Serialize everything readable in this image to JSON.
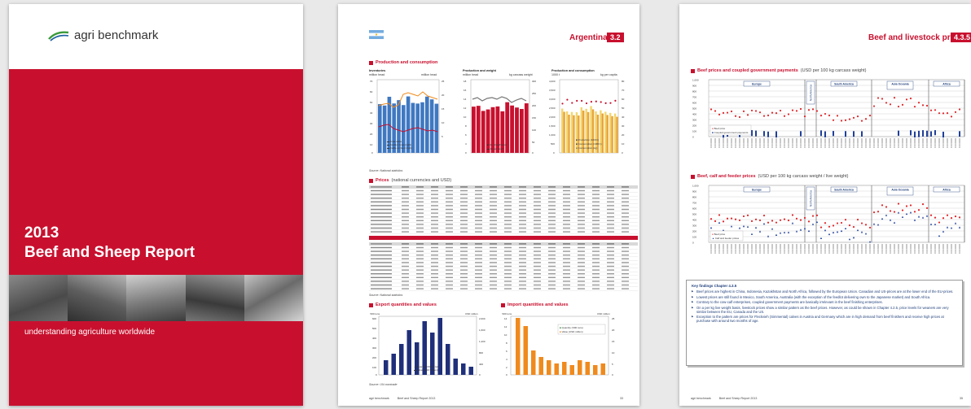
{
  "cover": {
    "logo": "agri benchmark",
    "year": "2013",
    "title": "Beef and Sheep Report",
    "tagline": "understanding agriculture worldwide",
    "colors": {
      "brand_red": "#c8102e",
      "logo_green": "#3a9a3a"
    }
  },
  "page_left": {
    "country": "Argentina",
    "section_no": "3.2",
    "flag_icon": "argentina-flag-icon",
    "sec_production": "Production and consumption",
    "chart_inventories": {
      "title": "Inventories",
      "unit_left": "million head",
      "unit_right": "million head"
    },
    "chart_production": {
      "title": "Production and weight",
      "unit_left": "million head",
      "unit_right": "kg carcass weight"
    },
    "chart_consumption": {
      "title": "Production and consumption",
      "unit_left": "1000 t",
      "unit_right": "kg per capita"
    },
    "source_stats": "Source: National statistics",
    "sec_prices": "Prices",
    "sec_prices_sub": "(national currencies and USD)",
    "source_stats2": "Source: National statistics",
    "sec_export": "Export quantities and values",
    "sec_import": "Import quantities and values",
    "source_comtrade": "Source: UN comtrade",
    "footer_brand": "agri benchmark",
    "footer_report": "Beef and Sheep Report 2013",
    "page_number": "33"
  },
  "page_right": {
    "header": "Beef and livestock prices",
    "section_no": "4.3.5",
    "sec_beef": "Beef prices and coupled government payments",
    "sec_beef_sub": "(USD per 100 kg carcass weight)",
    "sec_calf": "Beef, calf and feeder prices",
    "sec_calf_sub": "(USD per 100 kg carcass weight / live weight)",
    "regions": [
      "Europe",
      "North America",
      "South America",
      "Asia Oceania",
      "Africa"
    ],
    "key_findings_title": "Key findings  Chapter 4.3.5",
    "key_findings": [
      "Beef prices are highest in China, Indonesia, Kazakhstan and North Africa, followed by the European Union. Canadian and US-prices are at the lower end of the EU-prices.",
      "Lowest prices are still found in Mexico, South America, Australia (with the exception of the feedlot delivering own to the Japanese market) and South Africa.",
      "Contrary to the cow-calf enterprises, coupled government payments are basically irrelevant in the beef finishing enterprises.",
      "On a per kg live weight basis, livestock prices show a similar pattern as the beef prices. However, as could be shown in Chapter 4.2.5, price levels for weaners are very similar between the EU, Canada and the US.",
      "Exception to the pattern are prices for Fleckvieh (Simmental) calves in Austria and Germany which are in high demand from beef finishers and receive high prices at purchase with around two months of age."
    ],
    "footer_brand": "agri benchmark",
    "footer_report": "Beef and Sheep Report 2013",
    "page_number": "35"
  }
}
